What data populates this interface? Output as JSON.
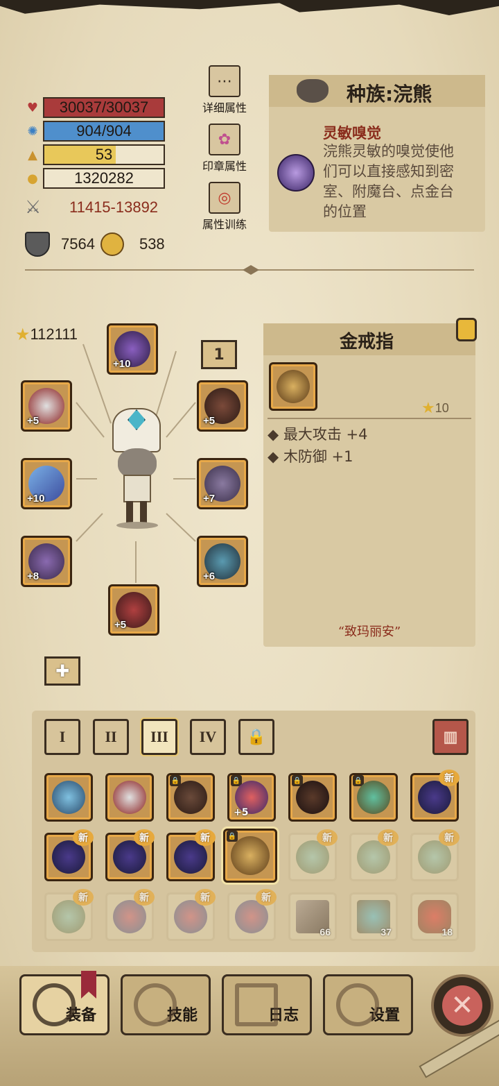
{
  "stats": {
    "hp": "30037/30037",
    "mp": "904/904",
    "level": "53",
    "level_fill": 0.6,
    "gold": "1320282",
    "attack": "11415-13892",
    "defense": "7564",
    "magic": "538"
  },
  "side_buttons": [
    {
      "label": "详细属性",
      "icon": "dots-icon"
    },
    {
      "label": "印章属性",
      "icon": "seal-icon"
    },
    {
      "label": "属性训练",
      "icon": "target-icon"
    }
  ],
  "race": {
    "title": "种族:浣熊",
    "trait_name": "灵敏嗅觉",
    "trait_desc_lines": [
      "浣熊灵敏的嗅觉使他",
      "们可以直接感知到密",
      "室、附魔台、点金台",
      "的位置"
    ]
  },
  "character": {
    "score": "112111",
    "page_badge": "1"
  },
  "equipment": [
    {
      "slot": "helmet",
      "plus": "+10"
    },
    {
      "slot": "amulet",
      "plus": "+5"
    },
    {
      "slot": "ring-left",
      "plus": "+5"
    },
    {
      "slot": "weapon",
      "plus": "+10"
    },
    {
      "slot": "shoulder",
      "plus": "+7"
    },
    {
      "slot": "gloves",
      "plus": "+8"
    },
    {
      "slot": "armor",
      "plus": "+6"
    },
    {
      "slot": "boots",
      "plus": "+5"
    }
  ],
  "item": {
    "name": "金戒指",
    "stars": "10",
    "attrs": [
      "最大攻击 +4",
      "木防御 +1"
    ],
    "flavor": "“致玛丽安”"
  },
  "tabs": [
    "I",
    "II",
    "III",
    "IV"
  ],
  "inventory_counts": [
    "66",
    "37",
    "18"
  ],
  "new_label": "新",
  "nav": {
    "equip": "装备",
    "skills": "技能",
    "log": "日志",
    "settings": "设置"
  }
}
